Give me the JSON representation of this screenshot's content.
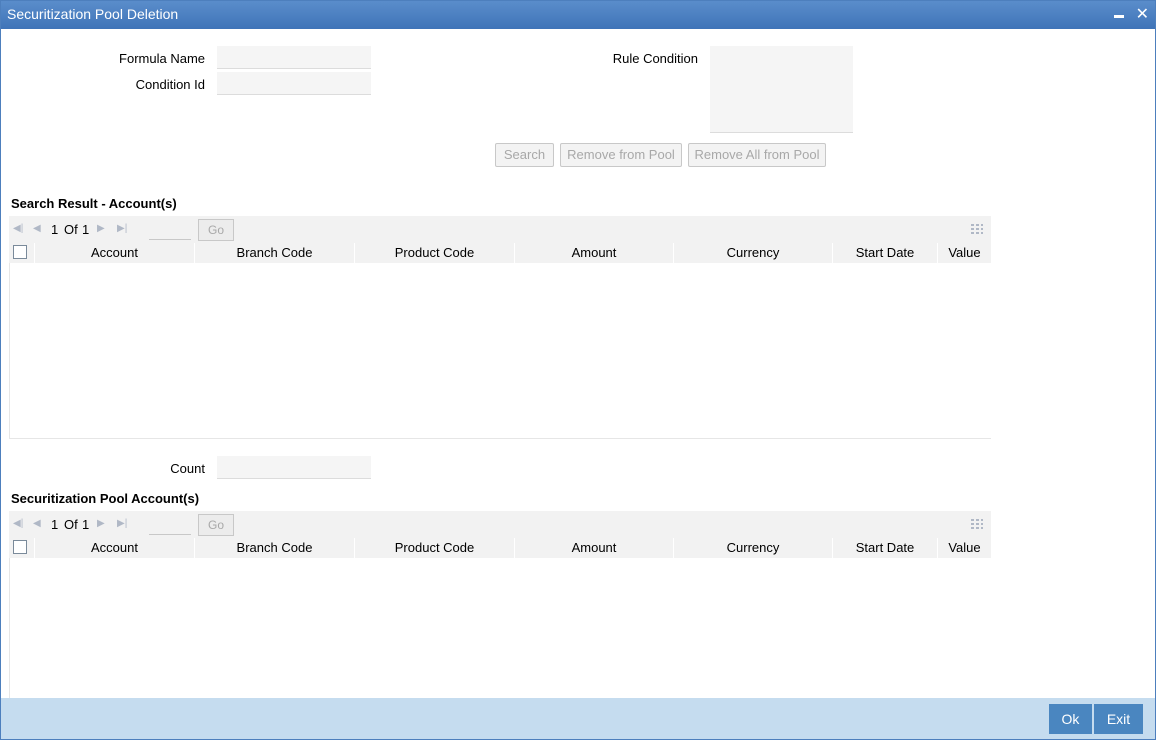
{
  "window": {
    "title": "Securitization Pool Deletion"
  },
  "form": {
    "formula_name_label": "Formula Name",
    "formula_name_value": "",
    "condition_id_label": "Condition Id",
    "condition_id_value": "",
    "rule_condition_label": "Rule Condition",
    "rule_condition_value": "",
    "count_label": "Count",
    "count_value": ""
  },
  "actions": {
    "search": "Search",
    "remove_from_pool": "Remove from Pool",
    "remove_all_from_pool": "Remove All from Pool"
  },
  "search_result": {
    "title": "Search Result - Account(s)",
    "page_current": "1",
    "page_of": "Of",
    "page_total": "1",
    "go": "Go",
    "columns": [
      "Account",
      "Branch Code",
      "Product Code",
      "Amount",
      "Currency",
      "Start Date",
      "Value"
    ],
    "rows": []
  },
  "pool_accounts": {
    "title": "Securitization Pool Account(s)",
    "page_current": "1",
    "page_of": "Of",
    "page_total": "1",
    "go": "Go",
    "columns": [
      "Account",
      "Branch Code",
      "Product Code",
      "Amount",
      "Currency",
      "Start Date",
      "Value"
    ],
    "rows": []
  },
  "footer": {
    "ok": "Ok",
    "exit": "Exit"
  },
  "icons": {
    "first_page": "first-page-icon",
    "prev_page": "prev-page-icon",
    "next_page": "next-page-icon",
    "last_page": "last-page-icon",
    "columns": "columns-icon",
    "minimize": "minimize-icon",
    "close": "close-icon"
  },
  "colors": {
    "titlebar": "#4a7fc1",
    "footer": "#c5dcef",
    "footer_button": "#4a86c0",
    "grid_header": "#f2f2f2"
  }
}
